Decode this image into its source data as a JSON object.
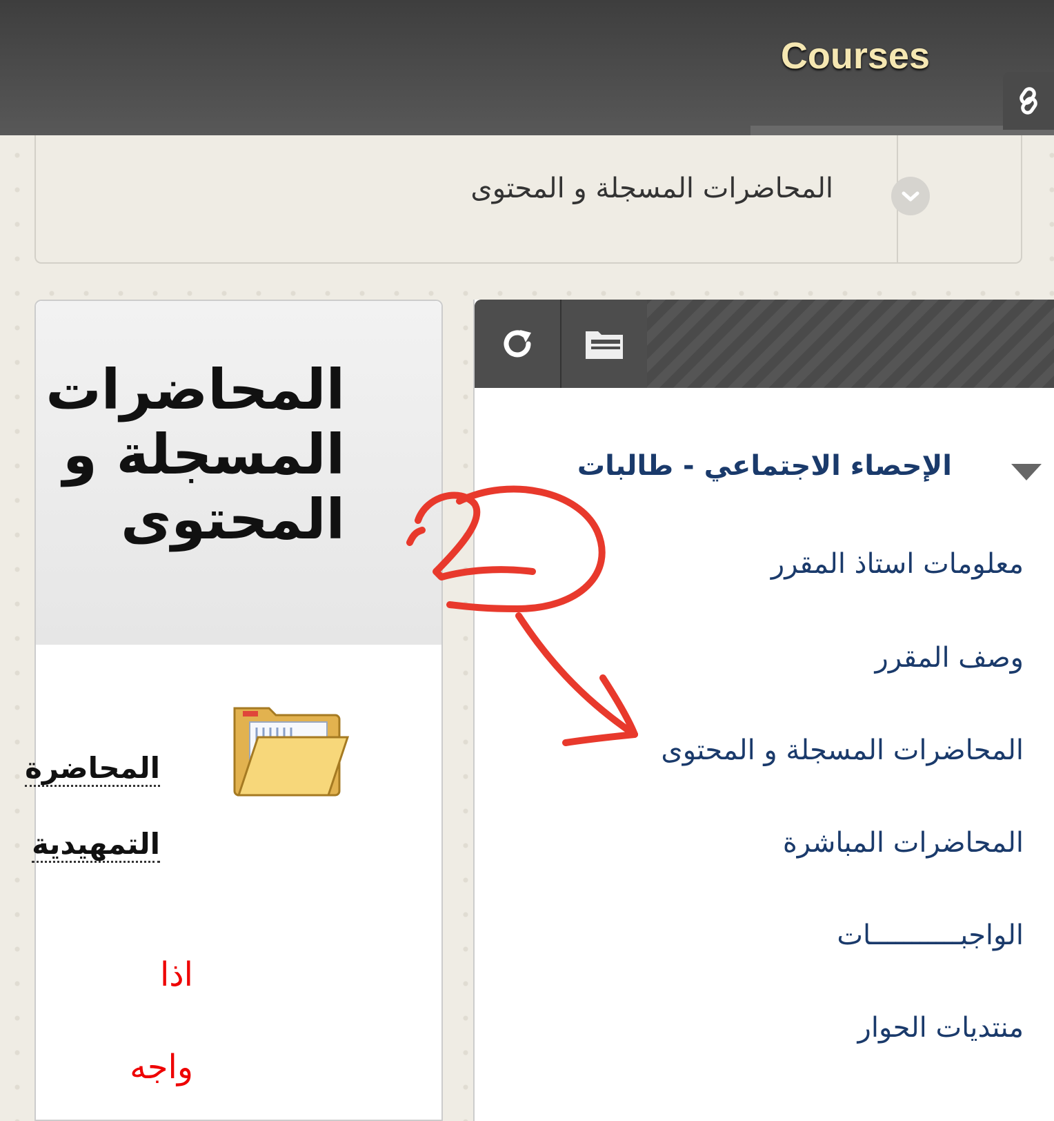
{
  "header": {
    "title": "Courses"
  },
  "breadcrumb": {
    "current": "المحاضرات المسجلة و المحتوى"
  },
  "content_panel": {
    "title": "المحاضرات المسجلة و المحتوى",
    "items": [
      {
        "title_line1": "المحاضرة",
        "title_line2": "التمهيدية",
        "icon": "folder-icon"
      }
    ],
    "red_note_line1": "اذا",
    "red_note_line2": "واجه"
  },
  "course_menu": {
    "course_name": "الإحصاء الاجتماعي - طالبات",
    "items": [
      {
        "label": "معلومات استاذ المقرر"
      },
      {
        "label": "وصف المقرر"
      },
      {
        "label": "المحاضرات المسجلة و المحتوى"
      },
      {
        "label": "المحاضرات المباشرة"
      },
      {
        "label": "الواجبـــــــــــات"
      },
      {
        "label": "منتديات الحوار"
      }
    ]
  },
  "annotation": {
    "number": "2",
    "color": "#e8392c"
  },
  "colors": {
    "topbar": "#4a4a4a",
    "title": "#f5e7b2",
    "menu_link": "#1a3a6b",
    "note": "#e00000"
  }
}
